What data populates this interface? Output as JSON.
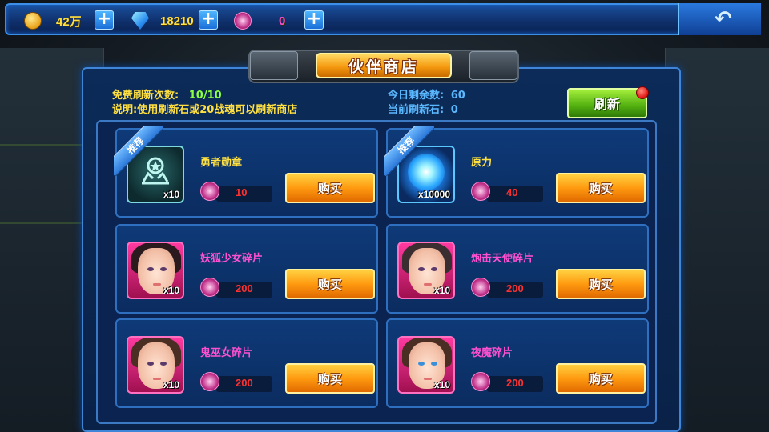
{
  "resources": {
    "coins": "42万",
    "gems": "18210",
    "crystals": "0"
  },
  "shop": {
    "title": "伙伴商店",
    "free_refresh_label": "免费刷新次数:",
    "free_refresh_value": "10/10",
    "description": "说明:使用刷新石或20战魂可以刷新商店",
    "remaining_label": "今日剩余数:",
    "remaining_value": "60",
    "refresh_stone_label": "当前刷新石:",
    "refresh_stone_value": "0",
    "refresh_button": "刷新"
  },
  "items": [
    {
      "name": "勇者勋章",
      "count": "x10",
      "price": "10",
      "badge": "推荐",
      "buy": "购买"
    },
    {
      "name": "原力",
      "count": "x10000",
      "price": "40",
      "badge": "推荐",
      "buy": "购买"
    },
    {
      "name": "妖狐少女碎片",
      "count": "x10",
      "price": "200",
      "buy": "购买"
    },
    {
      "name": "炮击天使碎片",
      "count": "x10",
      "price": "200",
      "buy": "购买"
    },
    {
      "name": "鬼巫女碎片",
      "count": "x10",
      "price": "200",
      "buy": "购买"
    },
    {
      "name": "夜魔碎片",
      "count": "x10",
      "price": "200",
      "buy": "购买"
    }
  ],
  "colors": {
    "accent_blue": "#3f85d8",
    "buy_orange": "#ff9a10",
    "refresh_green": "#52b010",
    "price_red": "#ff3030"
  }
}
